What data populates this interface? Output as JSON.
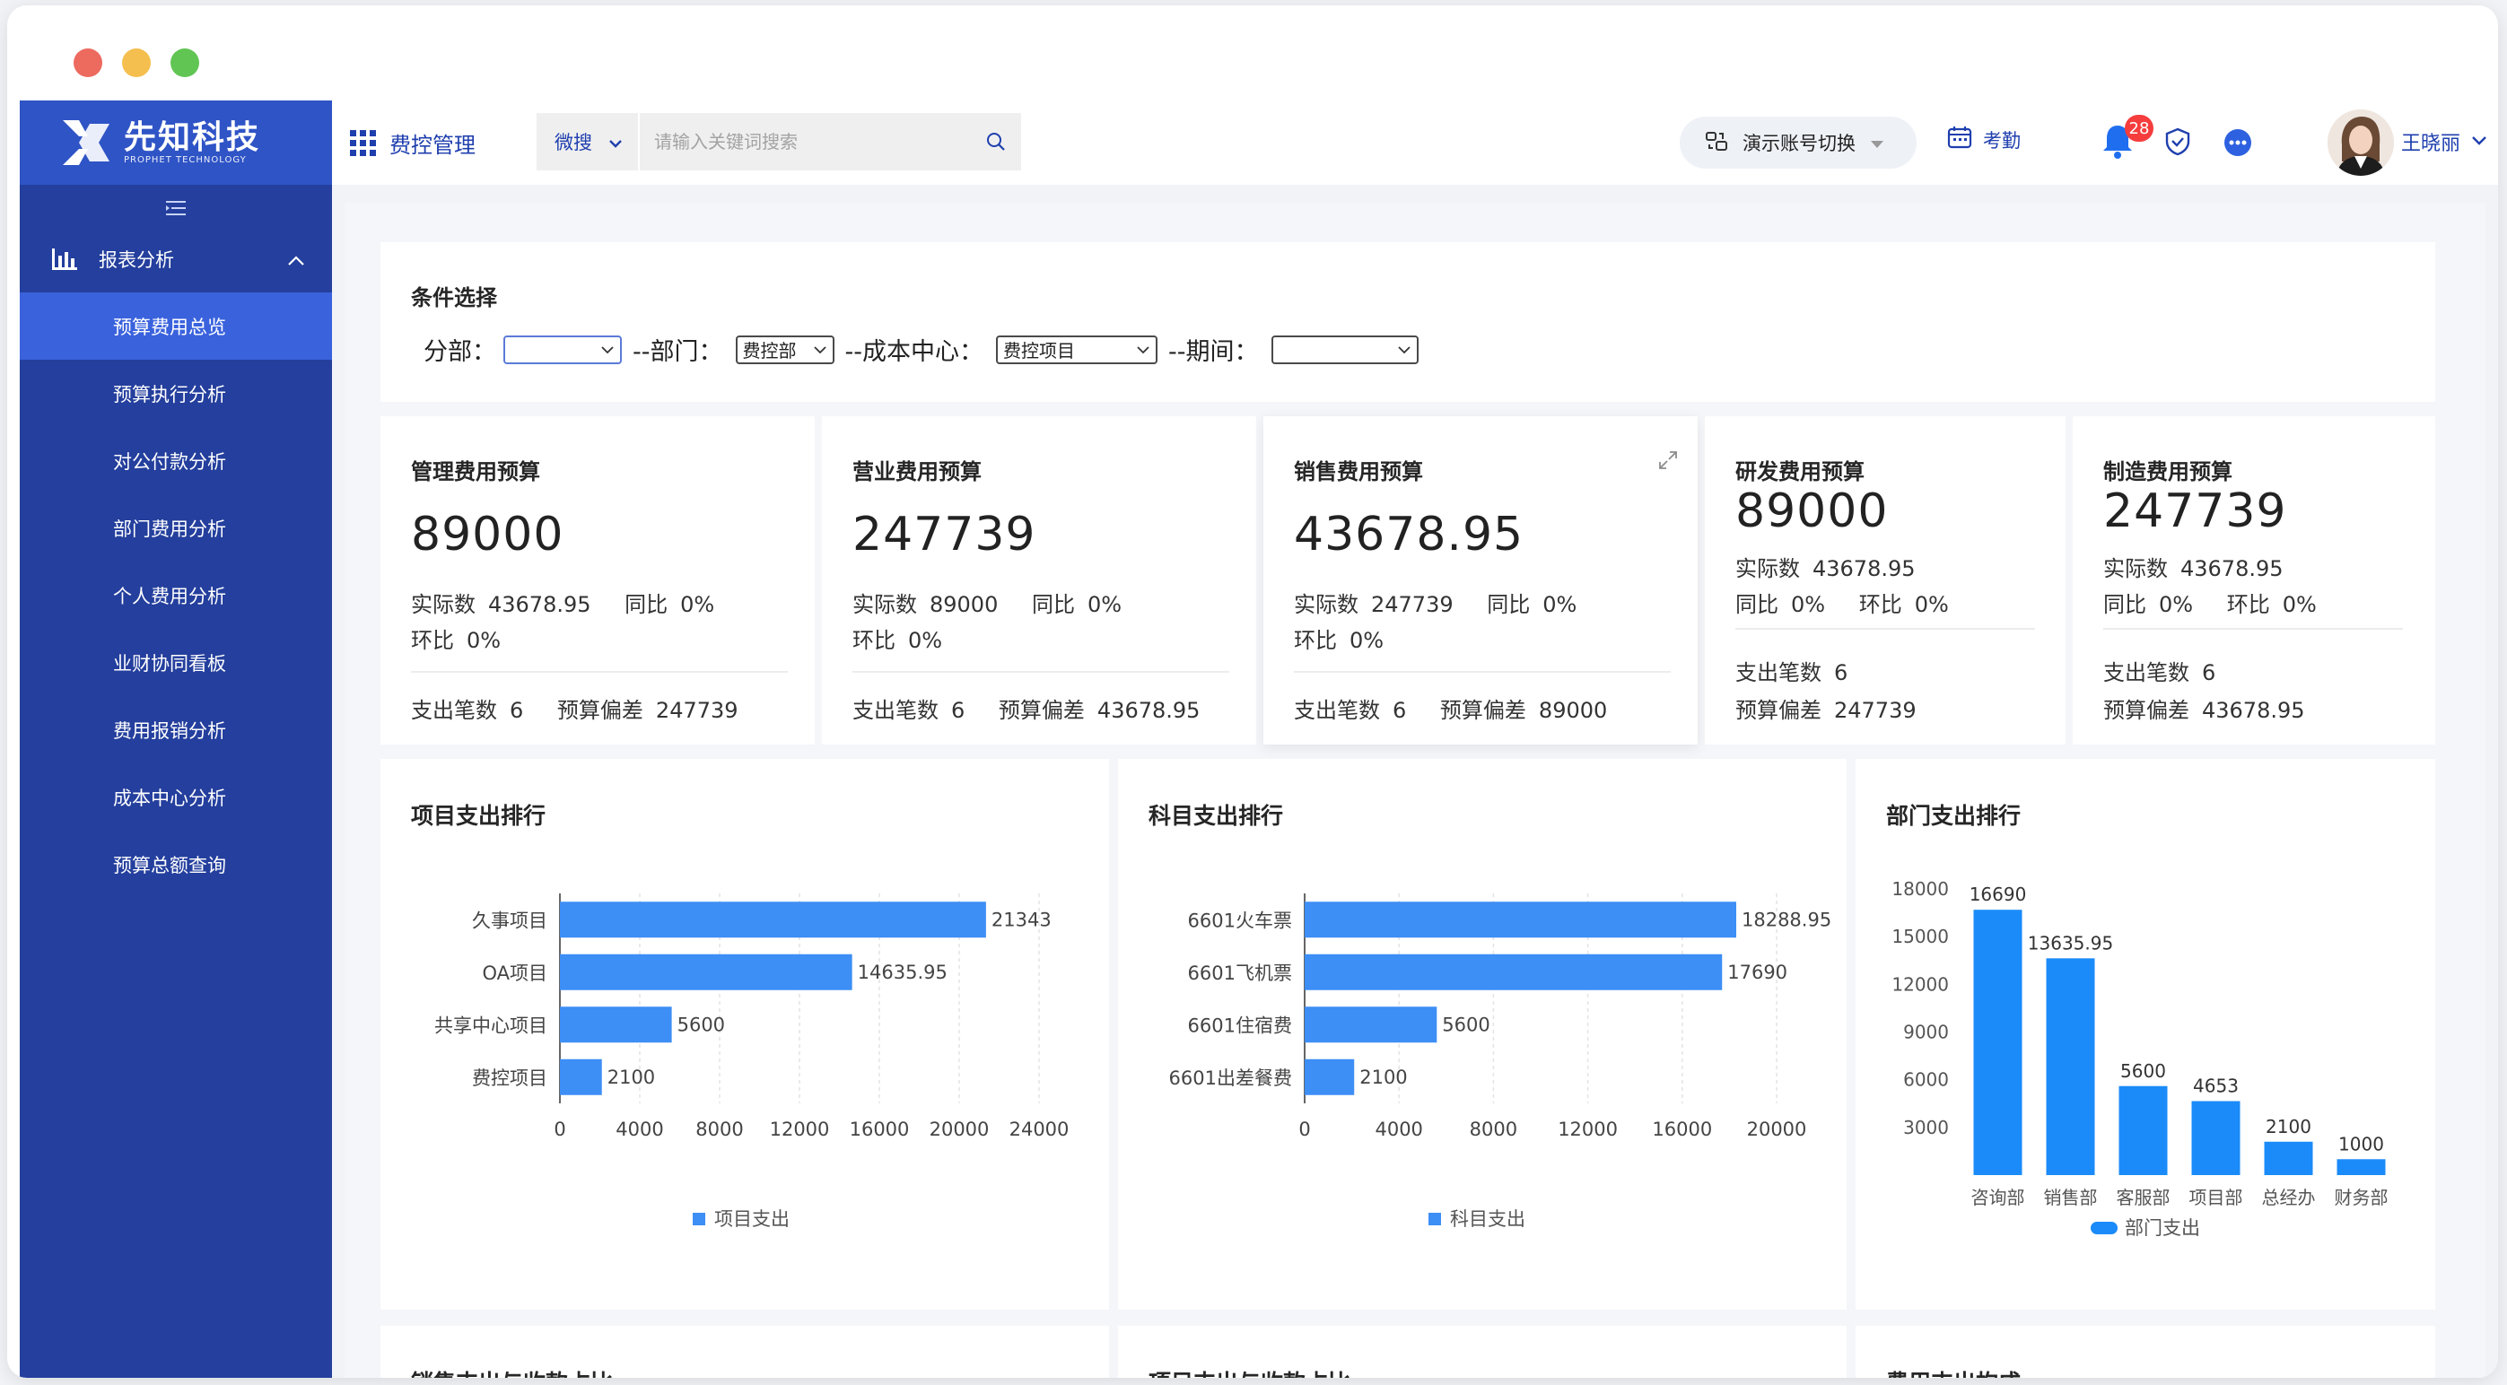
{
  "brand": {
    "name_cn": "先知科技",
    "name_en": "PROPHET TECHNOLOGY"
  },
  "topbar": {
    "module_title": "费控管理",
    "search_scope": "微搜",
    "search_placeholder": "请输入关键词搜索",
    "switch_account": "演示账号切换",
    "attendance": "考勤",
    "notification_count": "28",
    "username": "王晓丽"
  },
  "sidebar": {
    "group_label": "报表分析",
    "items": [
      {
        "label": "预算费用总览",
        "active": true
      },
      {
        "label": "预算执行分析"
      },
      {
        "label": "对公付款分析"
      },
      {
        "label": "部门费用分析"
      },
      {
        "label": "个人费用分析"
      },
      {
        "label": "业财协同看板"
      },
      {
        "label": "费用报销分析"
      },
      {
        "label": "成本中心分析"
      },
      {
        "label": "预算总额查询"
      }
    ]
  },
  "conditions": {
    "title": "条件选择",
    "branch_label": "分部：",
    "branch_value": "",
    "dept_label": "--部门：",
    "dept_value": "费控部",
    "cost_center_label": "--成本中心：",
    "cost_center_value": "费控项目",
    "period_label": "--期间：",
    "period_value": ""
  },
  "stats": [
    {
      "title": "管理费用预算",
      "budget": "89000",
      "actual_label": "实际数",
      "actual": "43678.95",
      "yoy_label": "同比",
      "yoy": "0%",
      "mom_label": "环比",
      "mom": "0%",
      "count_label": "支出笔数",
      "count": "6",
      "dev_label": "预算偏差",
      "dev": "247739"
    },
    {
      "title": "营业费用预算",
      "budget": "247739",
      "actual_label": "实际数",
      "actual": "89000",
      "yoy_label": "同比",
      "yoy": "0%",
      "mom_label": "环比",
      "mom": "0%",
      "count_label": "支出笔数",
      "count": "6",
      "dev_label": "预算偏差",
      "dev": "43678.95"
    },
    {
      "title": "销售费用预算",
      "budget": "43678.95",
      "actual_label": "实际数",
      "actual": "247739",
      "yoy_label": "同比",
      "yoy": "0%",
      "mom_label": "环比",
      "mom": "0%",
      "count_label": "支出笔数",
      "count": "6",
      "dev_label": "预算偏差",
      "dev": "89000"
    },
    {
      "title": "研发费用预算",
      "budget": "89000",
      "actual_label": "实际数",
      "actual": "43678.95",
      "yoy_label": "同比",
      "yoy": "0%",
      "mom_label": "环比",
      "mom": "0%",
      "count_label": "支出笔数",
      "count": "6",
      "dev_label": "预算偏差",
      "dev": "247739"
    },
    {
      "title": "制造费用预算",
      "budget": "247739",
      "actual_label": "实际数",
      "actual": "43678.95",
      "yoy_label": "同比",
      "yoy": "0%",
      "mom_label": "环比",
      "mom": "0%",
      "count_label": "支出笔数",
      "count": "6",
      "dev_label": "预算偏差",
      "dev": "43678.95"
    }
  ],
  "colors": {
    "bar": "#3d8ef5",
    "bar_dept": "#1b8bf9",
    "sidebar": "#243f9d",
    "sidebar_active": "#3a62dd",
    "accent": "#1f3fae"
  },
  "chart_data": [
    {
      "type": "bar",
      "orientation": "horizontal",
      "title": "项目支出排行",
      "categories": [
        "久事项目",
        "OA项目",
        "共享中心项目",
        "费控项目"
      ],
      "series": [
        {
          "name": "项目支出",
          "values": [
            21343,
            14635.95,
            5600,
            2100
          ]
        }
      ],
      "xlim": [
        0,
        24000
      ],
      "ticks": [
        0,
        4000,
        8000,
        12000,
        16000,
        20000,
        24000
      ],
      "grid": true,
      "legend": "bottom"
    },
    {
      "type": "bar",
      "orientation": "horizontal",
      "title": "科目支出排行",
      "categories": [
        "6601火车票",
        "6601飞机票",
        "6601住宿费",
        "6601出差餐费"
      ],
      "series": [
        {
          "name": "科目支出",
          "values": [
            18288.95,
            17690,
            5600,
            2100
          ]
        }
      ],
      "xlim": [
        0,
        20000
      ],
      "ticks": [
        0,
        4000,
        8000,
        12000,
        16000,
        20000
      ],
      "grid": true,
      "legend": "bottom"
    },
    {
      "type": "bar",
      "orientation": "vertical",
      "title": "部门支出排行",
      "categories": [
        "咨询部",
        "销售部",
        "客服部",
        "项目部",
        "总经办",
        "财务部"
      ],
      "series": [
        {
          "name": "部门支出",
          "values": [
            16690,
            13635.95,
            5600,
            4653,
            2100,
            1000
          ]
        }
      ],
      "ylim": [
        0,
        18000
      ],
      "ticks": [
        3000,
        6000,
        9000,
        12000,
        15000,
        18000
      ],
      "grid": false,
      "legend": "bottom"
    }
  ],
  "bottom_cards": [
    {
      "title": "销售支出与收款占比"
    },
    {
      "title": "项目支出与收款占比"
    },
    {
      "title": "费用支出构成"
    }
  ]
}
